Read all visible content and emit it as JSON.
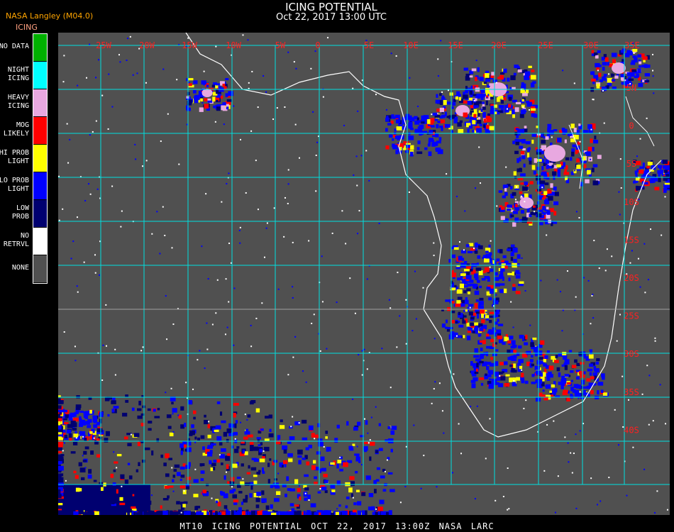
{
  "header": {
    "title": "ICING POTENTIAL",
    "subtitle": "Oct 22, 2017 13:00 UTC",
    "org": "NASA Langley (M04.0)"
  },
  "legend": {
    "title": "ICING",
    "items": [
      {
        "label": [
          "NO DATA"
        ],
        "color": "#00b000"
      },
      {
        "label": [
          "NIGHT",
          "ICING"
        ],
        "color": "#00ffff"
      },
      {
        "label": [
          "HEAVY",
          "ICING"
        ],
        "color": "#e8a8e0"
      },
      {
        "label": [
          "MOG",
          "LIKELY"
        ],
        "color": "#ff0000"
      },
      {
        "label": [
          "HI PROB",
          "LIGHT"
        ],
        "color": "#ffff00"
      },
      {
        "label": [
          "LO PROB",
          "LIGHT"
        ],
        "color": "#0000ff"
      },
      {
        "label": [
          "LOW",
          "PROB"
        ],
        "color": "#000070"
      },
      {
        "label": [
          "NO",
          "RETRVL"
        ],
        "color": "#ffffff"
      },
      {
        "label": [
          "NONE"
        ],
        "color": "#505050"
      }
    ]
  },
  "map": {
    "lon_labels": [
      "25W",
      "20W",
      "15W",
      "10W",
      "5W",
      "0",
      "5E",
      "10E",
      "15E",
      "20E",
      "25E",
      "30E",
      "35E"
    ],
    "lat_labels": [
      "5N",
      "0",
      "5S",
      "10S",
      "15S",
      "20S",
      "25S",
      "30S",
      "35S",
      "40S"
    ],
    "grid_color": "#00e0e0",
    "label_color": "#ff2020"
  },
  "footer": "MT10  ICING POTENTIAL  OCT 22, 2017 13:00Z  NASA LARC"
}
